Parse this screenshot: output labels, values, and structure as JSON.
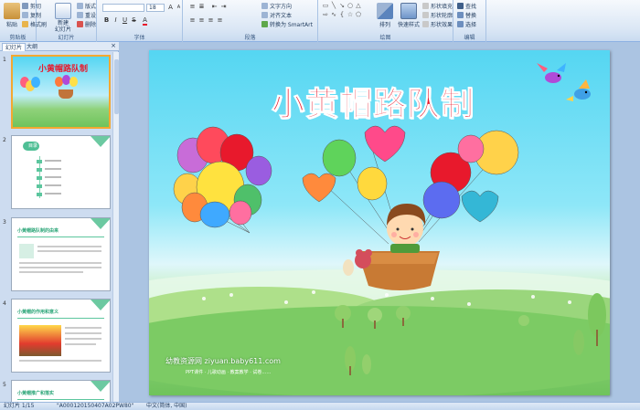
{
  "ribbon": {
    "clipboard": {
      "label": "剪贴板",
      "paste": "粘贴",
      "cut": "剪切",
      "copy": "复制",
      "format_painter": "格式刷"
    },
    "slides": {
      "label": "幻灯片",
      "new_slide": "新建\n幻灯片",
      "layout": "版式",
      "reset": "重设",
      "delete": "删除"
    },
    "font": {
      "label": "字体",
      "font_name": "",
      "font_size": "18"
    },
    "paragraph": {
      "label": "段落",
      "text_direction": "文字方向",
      "align_text": "对齐文本",
      "smartart": "转换为 SmartArt"
    },
    "drawing": {
      "label": "绘图",
      "arrange": "排列",
      "quick_styles": "快速样式",
      "shape_fill": "形状填充",
      "shape_outline": "形状轮廓",
      "shape_effects": "形状效果"
    },
    "editing": {
      "label": "编辑",
      "find": "查找",
      "replace": "替换",
      "select": "选择"
    }
  },
  "panel": {
    "tab_slides": "幻灯片",
    "tab_outline": "大纲",
    "close": "×",
    "thumbnails": [
      {
        "number": "1",
        "title": "小黄帽路队制"
      },
      {
        "number": "2",
        "title": "目录"
      },
      {
        "number": "3",
        "title": "小黄帽路队制的由来"
      },
      {
        "number": "4",
        "title": "小黄帽的作用和意义"
      },
      {
        "number": "5",
        "title": "小黄帽推广和落实"
      }
    ]
  },
  "slide": {
    "title": "小黄帽路队制",
    "watermark": "幼教资源网 ziyuan.baby611.com",
    "watermark_sub": "PPT课件 · 儿歌动画 · 教案教学 · 试卷……"
  },
  "statusbar": {
    "slide_count": "幻灯片 1/15",
    "theme": "\"A0001201504​07A02PW80\"",
    "language": "中文(简体, 中国)"
  },
  "colors": {
    "title_red": "#e8192c",
    "sky_top": "#55d6f2",
    "grass": "#6fc35c",
    "ribbon_bg": "#dbe7f5",
    "selected_border": "#f4a830"
  }
}
